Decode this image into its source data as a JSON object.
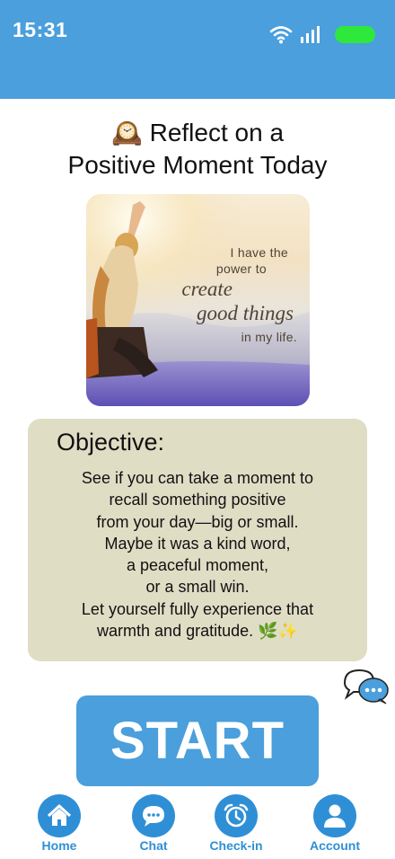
{
  "status_bar": {
    "time": "15:31",
    "icons": [
      "wifi-icon",
      "cellular-signal-icon",
      "battery-icon"
    ],
    "background_color": "#4a9fdc",
    "battery_color": "#2ee83b"
  },
  "title": {
    "emoji": "🕰️",
    "line1": "Reflect on a",
    "line2": "Positive Moment Today"
  },
  "hero_image": {
    "quote_line1": "I have the",
    "quote_line2": "power to",
    "quote_line3": "create",
    "quote_line4": "good things",
    "quote_line5": "in my life."
  },
  "objective": {
    "heading": "Objective:",
    "lines": [
      "See if you can take a moment to",
      "recall something positive",
      "from your day—big or small.",
      "Maybe it was a kind word,",
      "a peaceful moment,",
      "or a small win.",
      "Let yourself fully experience that",
      "warmth and gratitude. 🌿✨"
    ],
    "background_color": "#e0ddc5"
  },
  "chat_float": {
    "icon": "chat-bubbles-icon"
  },
  "start_button": {
    "label": "START",
    "color": "#4a9fdc"
  },
  "nav": {
    "accent_color": "#2f8fd6",
    "items": [
      {
        "label": "Home",
        "icon": "home-icon"
      },
      {
        "label": "Chat",
        "icon": "chat-icon"
      },
      {
        "label": "Check-in",
        "icon": "alarm-clock-icon"
      },
      {
        "label": "Account",
        "icon": "user-icon"
      }
    ]
  }
}
